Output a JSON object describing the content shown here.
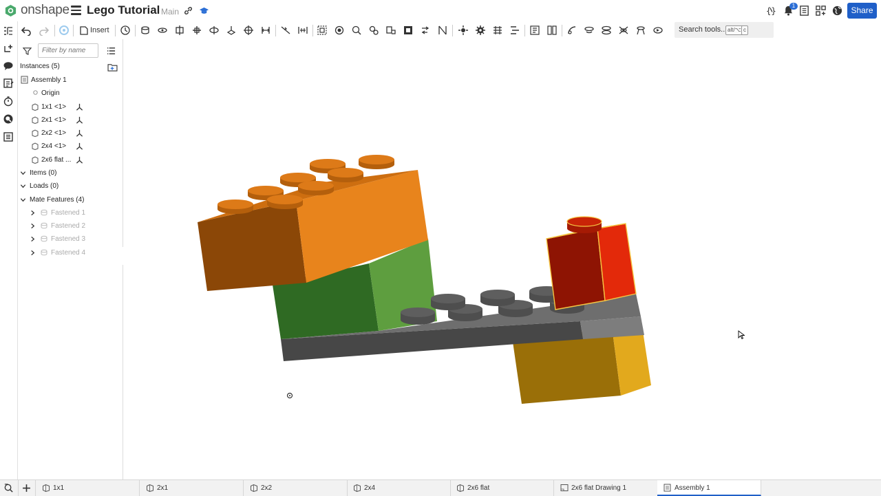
{
  "app": {
    "brand": "onshape",
    "document_title": "Lego Tutorial",
    "branch": "Main",
    "share_label": "Share",
    "notification_count": "1"
  },
  "toolbar": {
    "insert_label": "Insert",
    "search_label": "Search tools...",
    "shortcut_1": "alt/⌥",
    "shortcut_2": "c"
  },
  "panel": {
    "filter_placeholder": "Filter by name",
    "instances_header": "Instances (5)",
    "assembly": "Assembly 1",
    "origin": "Origin",
    "instances": [
      "1x1 <1>",
      "2x1 <1>",
      "2x2 <1>",
      "2x4 <1>",
      "2x6 flat ..."
    ],
    "items": "Items (0)",
    "loads": "Loads (0)",
    "mate_features": "Mate Features (4)",
    "mates": [
      "Fastened 1",
      "Fastened 2",
      "Fastened 3",
      "Fastened 4"
    ]
  },
  "tabs": [
    {
      "label": "1x1",
      "active": false
    },
    {
      "label": "2x1",
      "active": false
    },
    {
      "label": "2x2",
      "active": false
    },
    {
      "label": "2x4",
      "active": false
    },
    {
      "label": "2x6 flat",
      "active": false
    },
    {
      "label": "2x6 flat Drawing 1",
      "active": false
    },
    {
      "label": "Assembly 1",
      "active": true
    }
  ],
  "colors": {
    "accent": "#1f5fc8",
    "brand_green": "#4aa96c",
    "orange_brick": "#e07a1a",
    "green_brick": "#4f8f36",
    "gray_plate": "#5a5a5a",
    "yellow_brick": "#d9a01e",
    "red_brick": "#d42a0a",
    "selection_highlight": "#f5c542"
  }
}
